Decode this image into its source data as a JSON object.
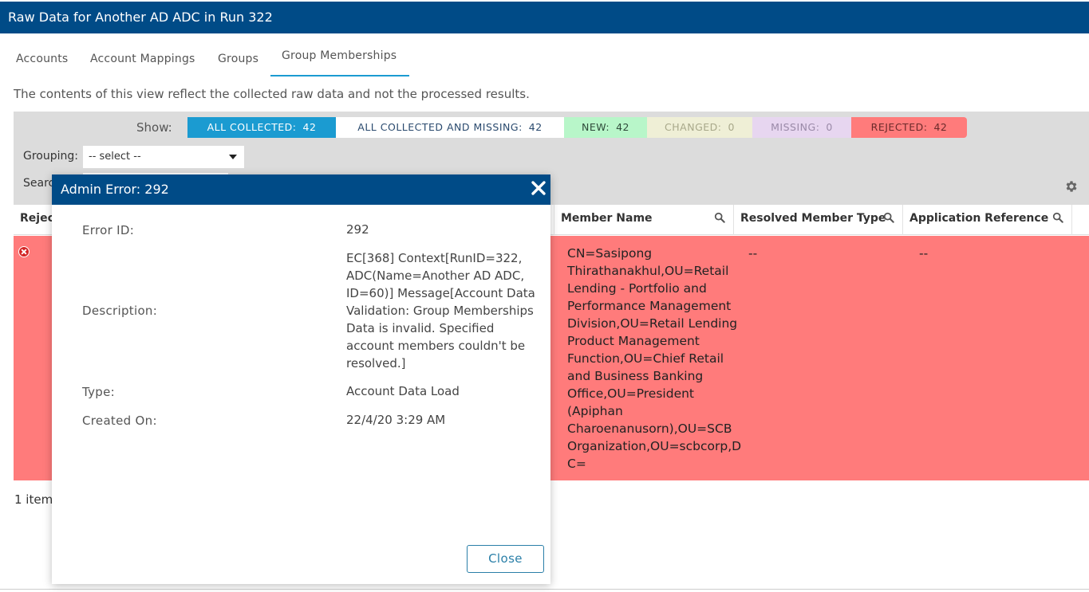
{
  "window": {
    "title": "Raw Data for Another AD ADC in Run 322"
  },
  "tabs": [
    {
      "label": "Accounts"
    },
    {
      "label": "Account Mappings"
    },
    {
      "label": "Groups"
    },
    {
      "label": "Group Memberships"
    }
  ],
  "info_text": "The contents of this view reflect the collected raw data and not the processed results.",
  "filters": {
    "show_label": "Show:",
    "chips": [
      {
        "label": "ALL COLLECTED:",
        "count": "42"
      },
      {
        "label": "ALL COLLECTED AND MISSING:",
        "count": "42"
      },
      {
        "label": "NEW:",
        "count": "42"
      },
      {
        "label": "CHANGED:",
        "count": "0"
      },
      {
        "label": "MISSING:",
        "count": "0"
      },
      {
        "label": "REJECTED:",
        "count": "42"
      }
    ],
    "grouping_label": "Grouping:",
    "grouping_value": "-- select --",
    "search_label": "Searc"
  },
  "grid": {
    "columns": [
      {
        "label": "Rejec"
      },
      {
        "label": "Member Name"
      },
      {
        "label": "Resolved Member Type"
      },
      {
        "label": "Application Reference"
      }
    ],
    "row": {
      "member_name_lines": [
        "CN=Sasipong",
        "Thirathanakhul,OU=Retail",
        "Lending - Portfolio and",
        "Performance Management",
        "Division,OU=Retail Lending",
        "Product Management",
        "Function,OU=Chief Retail",
        "and Business Banking",
        "Office,OU=President",
        "(Apiphan",
        "Charoenanusorn),OU=SCB",
        "Organization,OU=scbcorp,D",
        "C="
      ],
      "resolved_member_type": "--",
      "application_reference": "--"
    },
    "item_count": "1 item"
  },
  "modal": {
    "title": "Admin Error: 292",
    "fields": {
      "error_id_label": "Error ID:",
      "error_id_value": "292",
      "description_label": "Description:",
      "description_lines": [
        "EC[368] Context[RunID=322,",
        "ADC(Name=Another AD ADC,",
        "ID=60)] Message[Account Data",
        "Validation: Group Memberships",
        "Data is invalid. Specified",
        "account members couldn't be",
        "resolved.]"
      ],
      "type_label": "Type:",
      "type_value": "Account Data Load",
      "created_label": "Created On:",
      "created_value": "22/4/20 3:29 AM"
    },
    "close_button": "Close"
  },
  "icons": {
    "gear": "gear-icon",
    "search": "magnifier-icon",
    "close": "close-x-icon",
    "error": "error-circle-icon"
  },
  "colors": {
    "header_blue": "#004b87",
    "accent_blue": "#1b9bd1",
    "rejected_red": "#ff7b7b",
    "new_green": "#b8f6c9"
  }
}
